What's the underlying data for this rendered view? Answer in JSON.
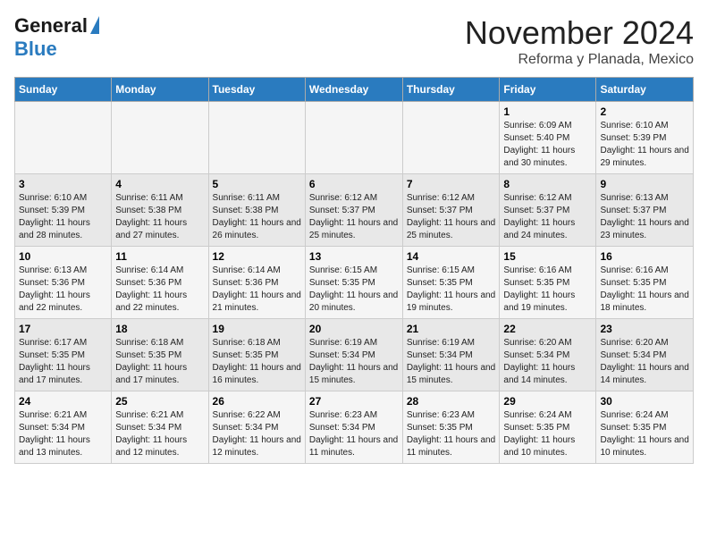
{
  "header": {
    "logo_line1": "General",
    "logo_line2": "Blue",
    "title": "November 2024",
    "subtitle": "Reforma y Planada, Mexico"
  },
  "calendar": {
    "days_of_week": [
      "Sunday",
      "Monday",
      "Tuesday",
      "Wednesday",
      "Thursday",
      "Friday",
      "Saturday"
    ],
    "weeks": [
      [
        {
          "day": "",
          "info": ""
        },
        {
          "day": "",
          "info": ""
        },
        {
          "day": "",
          "info": ""
        },
        {
          "day": "",
          "info": ""
        },
        {
          "day": "",
          "info": ""
        },
        {
          "day": "1",
          "info": "Sunrise: 6:09 AM\nSunset: 5:40 PM\nDaylight: 11 hours and 30 minutes."
        },
        {
          "day": "2",
          "info": "Sunrise: 6:10 AM\nSunset: 5:39 PM\nDaylight: 11 hours and 29 minutes."
        }
      ],
      [
        {
          "day": "3",
          "info": "Sunrise: 6:10 AM\nSunset: 5:39 PM\nDaylight: 11 hours and 28 minutes."
        },
        {
          "day": "4",
          "info": "Sunrise: 6:11 AM\nSunset: 5:38 PM\nDaylight: 11 hours and 27 minutes."
        },
        {
          "day": "5",
          "info": "Sunrise: 6:11 AM\nSunset: 5:38 PM\nDaylight: 11 hours and 26 minutes."
        },
        {
          "day": "6",
          "info": "Sunrise: 6:12 AM\nSunset: 5:37 PM\nDaylight: 11 hours and 25 minutes."
        },
        {
          "day": "7",
          "info": "Sunrise: 6:12 AM\nSunset: 5:37 PM\nDaylight: 11 hours and 25 minutes."
        },
        {
          "day": "8",
          "info": "Sunrise: 6:12 AM\nSunset: 5:37 PM\nDaylight: 11 hours and 24 minutes."
        },
        {
          "day": "9",
          "info": "Sunrise: 6:13 AM\nSunset: 5:37 PM\nDaylight: 11 hours and 23 minutes."
        }
      ],
      [
        {
          "day": "10",
          "info": "Sunrise: 6:13 AM\nSunset: 5:36 PM\nDaylight: 11 hours and 22 minutes."
        },
        {
          "day": "11",
          "info": "Sunrise: 6:14 AM\nSunset: 5:36 PM\nDaylight: 11 hours and 22 minutes."
        },
        {
          "day": "12",
          "info": "Sunrise: 6:14 AM\nSunset: 5:36 PM\nDaylight: 11 hours and 21 minutes."
        },
        {
          "day": "13",
          "info": "Sunrise: 6:15 AM\nSunset: 5:35 PM\nDaylight: 11 hours and 20 minutes."
        },
        {
          "day": "14",
          "info": "Sunrise: 6:15 AM\nSunset: 5:35 PM\nDaylight: 11 hours and 19 minutes."
        },
        {
          "day": "15",
          "info": "Sunrise: 6:16 AM\nSunset: 5:35 PM\nDaylight: 11 hours and 19 minutes."
        },
        {
          "day": "16",
          "info": "Sunrise: 6:16 AM\nSunset: 5:35 PM\nDaylight: 11 hours and 18 minutes."
        }
      ],
      [
        {
          "day": "17",
          "info": "Sunrise: 6:17 AM\nSunset: 5:35 PM\nDaylight: 11 hours and 17 minutes."
        },
        {
          "day": "18",
          "info": "Sunrise: 6:18 AM\nSunset: 5:35 PM\nDaylight: 11 hours and 17 minutes."
        },
        {
          "day": "19",
          "info": "Sunrise: 6:18 AM\nSunset: 5:35 PM\nDaylight: 11 hours and 16 minutes."
        },
        {
          "day": "20",
          "info": "Sunrise: 6:19 AM\nSunset: 5:34 PM\nDaylight: 11 hours and 15 minutes."
        },
        {
          "day": "21",
          "info": "Sunrise: 6:19 AM\nSunset: 5:34 PM\nDaylight: 11 hours and 15 minutes."
        },
        {
          "day": "22",
          "info": "Sunrise: 6:20 AM\nSunset: 5:34 PM\nDaylight: 11 hours and 14 minutes."
        },
        {
          "day": "23",
          "info": "Sunrise: 6:20 AM\nSunset: 5:34 PM\nDaylight: 11 hours and 14 minutes."
        }
      ],
      [
        {
          "day": "24",
          "info": "Sunrise: 6:21 AM\nSunset: 5:34 PM\nDaylight: 11 hours and 13 minutes."
        },
        {
          "day": "25",
          "info": "Sunrise: 6:21 AM\nSunset: 5:34 PM\nDaylight: 11 hours and 12 minutes."
        },
        {
          "day": "26",
          "info": "Sunrise: 6:22 AM\nSunset: 5:34 PM\nDaylight: 11 hours and 12 minutes."
        },
        {
          "day": "27",
          "info": "Sunrise: 6:23 AM\nSunset: 5:34 PM\nDaylight: 11 hours and 11 minutes."
        },
        {
          "day": "28",
          "info": "Sunrise: 6:23 AM\nSunset: 5:35 PM\nDaylight: 11 hours and 11 minutes."
        },
        {
          "day": "29",
          "info": "Sunrise: 6:24 AM\nSunset: 5:35 PM\nDaylight: 11 hours and 10 minutes."
        },
        {
          "day": "30",
          "info": "Sunrise: 6:24 AM\nSunset: 5:35 PM\nDaylight: 11 hours and 10 minutes."
        }
      ]
    ]
  }
}
